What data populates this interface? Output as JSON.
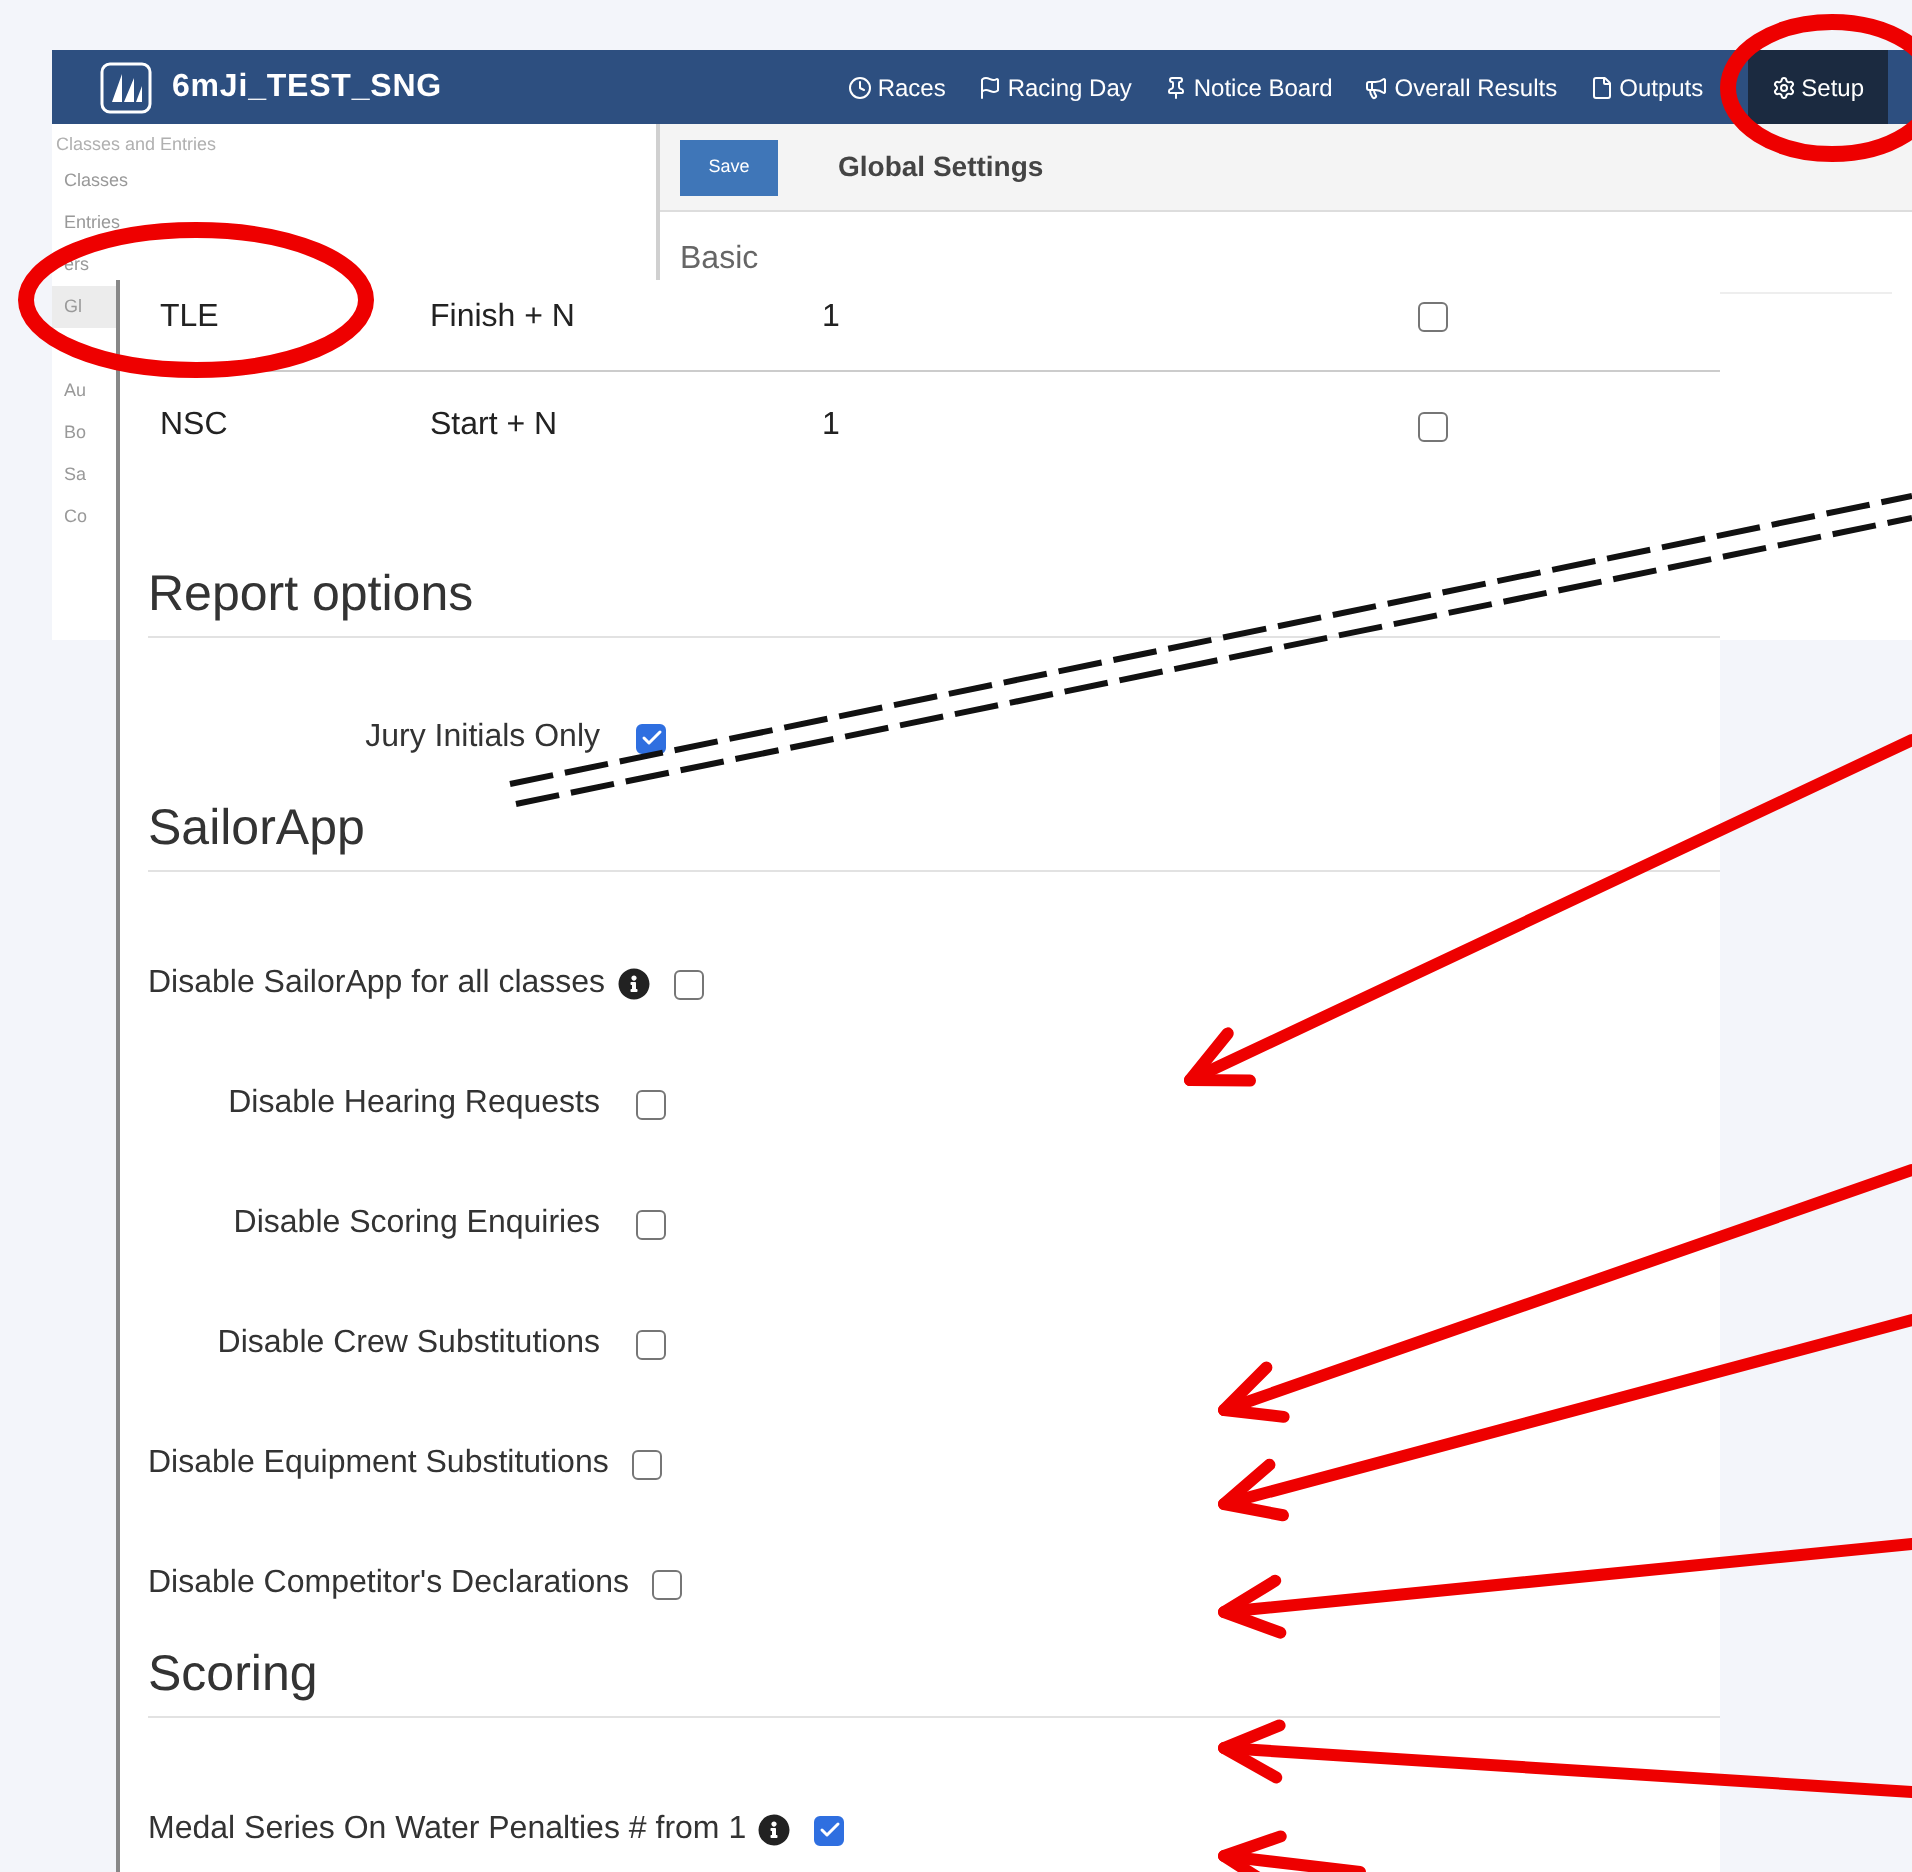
{
  "navbar": {
    "title": "6mJi_TEST_SNG",
    "items": [
      {
        "label": "Races",
        "selected": false
      },
      {
        "label": "Racing Day",
        "selected": false
      },
      {
        "label": "Notice Board",
        "selected": false
      },
      {
        "label": "Overall Results",
        "selected": false
      },
      {
        "label": "Outputs",
        "selected": false
      },
      {
        "label": "Setup",
        "selected": true
      }
    ]
  },
  "sidebar": {
    "heading": "Classes and Entries",
    "items": [
      {
        "label": "Classes",
        "selected": false
      },
      {
        "label": "Entries",
        "selected": false
      },
      {
        "label": "ers",
        "selected": false
      },
      {
        "label": "Gl",
        "selected": true
      },
      {
        "label": "Au",
        "selected": false
      },
      {
        "label": "Bo",
        "selected": false
      },
      {
        "label": "Sa",
        "selected": false
      },
      {
        "label": "Co",
        "selected": false
      }
    ]
  },
  "header": {
    "save_button": "Save",
    "title": "Global Settings"
  },
  "basic_heading": "Basic",
  "penalty_rows": [
    {
      "code": "TLE",
      "formula": "Finish + N",
      "value": "1",
      "checked": false
    },
    {
      "code": "NSC",
      "formula": "Start + N",
      "value": "1",
      "checked": false
    }
  ],
  "sections": [
    {
      "title": "Report options",
      "options": [
        {
          "label": "Jury Initials Only",
          "kind": "aligned",
          "info": false,
          "checked": true
        }
      ]
    },
    {
      "title": "SailorApp",
      "options": [
        {
          "label": "Disable SailorApp for all classes",
          "kind": "inline",
          "info": true,
          "checked": false
        },
        {
          "label": "Disable Hearing Requests",
          "kind": "aligned",
          "info": false,
          "checked": false
        },
        {
          "label": "Disable Scoring Enquiries",
          "kind": "aligned",
          "info": false,
          "checked": false
        },
        {
          "label": "Disable Crew Substitutions",
          "kind": "aligned",
          "info": false,
          "checked": false
        },
        {
          "label": "Disable Equipment Substitutions",
          "kind": "inline",
          "info": false,
          "checked": false
        },
        {
          "label": "Disable Competitor's Declarations",
          "kind": "inline",
          "info": false,
          "checked": false
        }
      ]
    },
    {
      "title": "Scoring",
      "options": [
        {
          "label": "Medal Series On Water Penalties # from 1",
          "kind": "inline",
          "info": true,
          "checked": true
        }
      ]
    }
  ]
}
